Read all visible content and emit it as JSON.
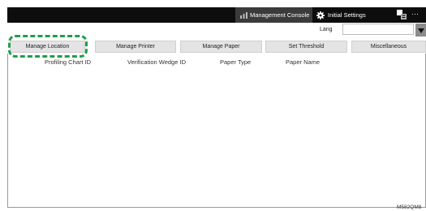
{
  "topbar": {
    "management_console": "Management Console",
    "initial_settings": "Initial Settings",
    "more": "···",
    "help": "?"
  },
  "language": {
    "label": "Lang",
    "value": ""
  },
  "tabs": [
    {
      "label": "Manage Location",
      "selected": true
    },
    {
      "label": "Manage Printer",
      "selected": false
    },
    {
      "label": "Manage Paper",
      "selected": false
    },
    {
      "label": "Set Threshold",
      "selected": false
    },
    {
      "label": "Miscellaneous",
      "selected": false
    }
  ],
  "table": {
    "columns": [
      "Profiling Chart ID",
      "Verification Wedge ID",
      "Paper Type",
      "Paper Name"
    ],
    "rows": []
  },
  "figure_caption": "M582QM8",
  "colors": {
    "topbar_bg": "#0d0d0d",
    "highlight": "#1f9e4b",
    "tab_bg": "#e4e4e4"
  },
  "icons": {
    "management_console": "chart-icon",
    "initial_settings": "gear-icon",
    "language": "language-icon",
    "dropdown": "triangle-down-icon"
  }
}
